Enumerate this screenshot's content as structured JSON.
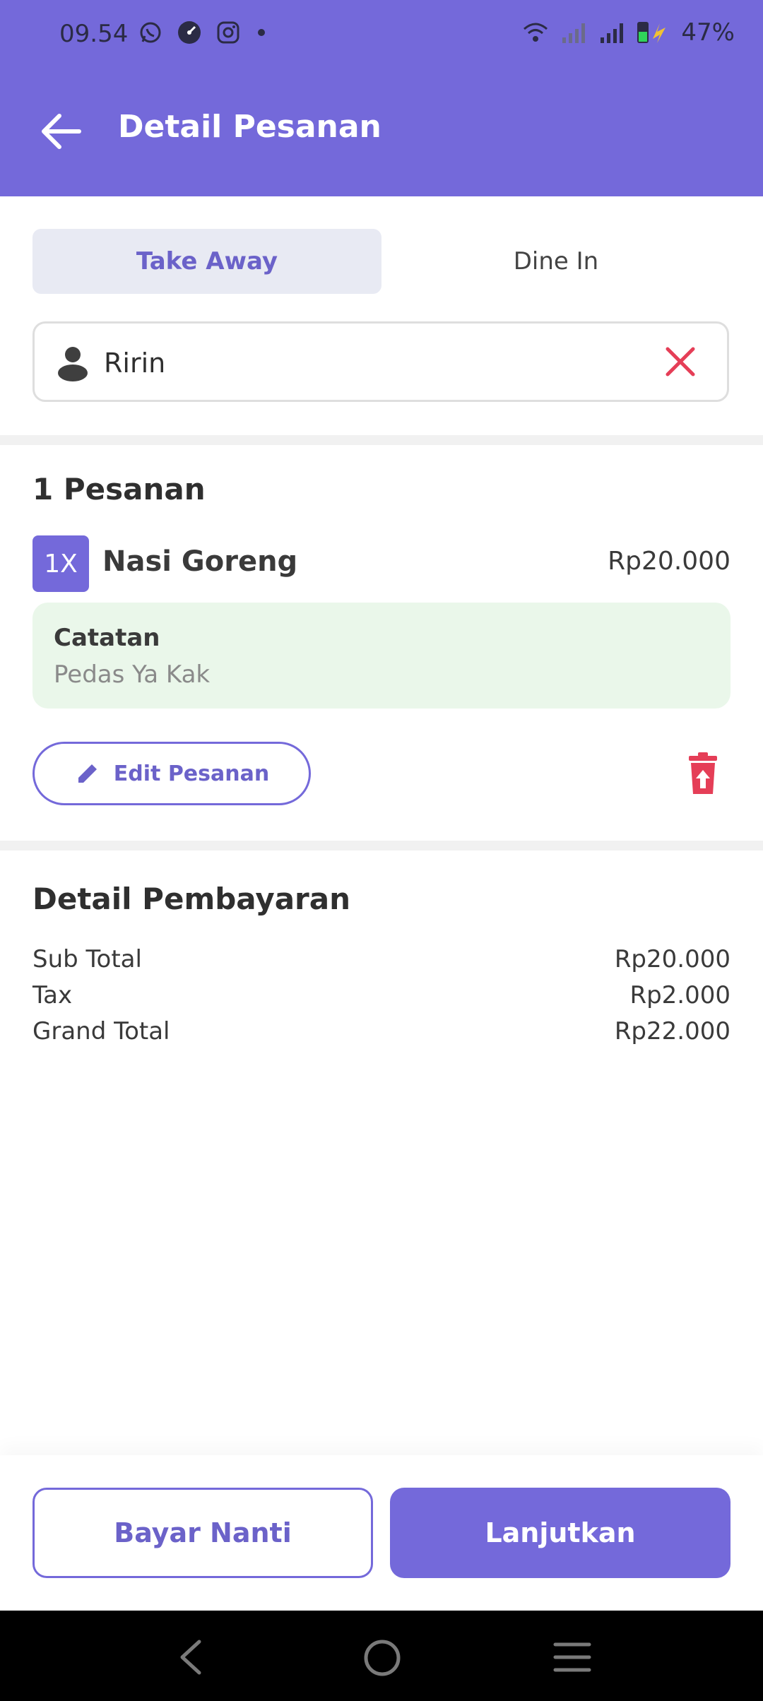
{
  "status_bar": {
    "time": "09.54",
    "battery": "47%",
    "icons": [
      "whatsapp-icon",
      "speedometer-icon",
      "instagram-icon",
      "dot-icon",
      "wifi-icon",
      "signal-icon",
      "battery-icon"
    ]
  },
  "colors": {
    "primary": "#7469da",
    "danger": "#e53e57",
    "note_bg": "#eaf7ea"
  },
  "app_bar": {
    "title": "Detail Pesanan",
    "back_icon": "arrow-left-icon"
  },
  "order_type": {
    "options": [
      "Take Away",
      "Dine In"
    ],
    "selected": "Take Away"
  },
  "customer": {
    "name": "Ririn"
  },
  "orders": {
    "count_label": "1 Pesanan",
    "items": [
      {
        "qty": "1X",
        "name": "Nasi Goreng",
        "price": "Rp20.000",
        "note_label": "Catatan",
        "note": "Pedas Ya Kak",
        "edit_label": "Edit Pesanan"
      }
    ]
  },
  "payment": {
    "title": "Detail Pembayaran",
    "rows": [
      {
        "label": "Sub Total",
        "value": "Rp20.000"
      },
      {
        "label": "Tax",
        "value": "Rp2.000"
      },
      {
        "label": "Grand Total",
        "value": "Rp22.000"
      }
    ]
  },
  "actions": {
    "pay_later": "Bayar Nanti",
    "continue": "Lanjutkan"
  },
  "nav_bar": {
    "icons": [
      "back-nav-icon",
      "home-nav-icon",
      "recents-nav-icon"
    ]
  }
}
